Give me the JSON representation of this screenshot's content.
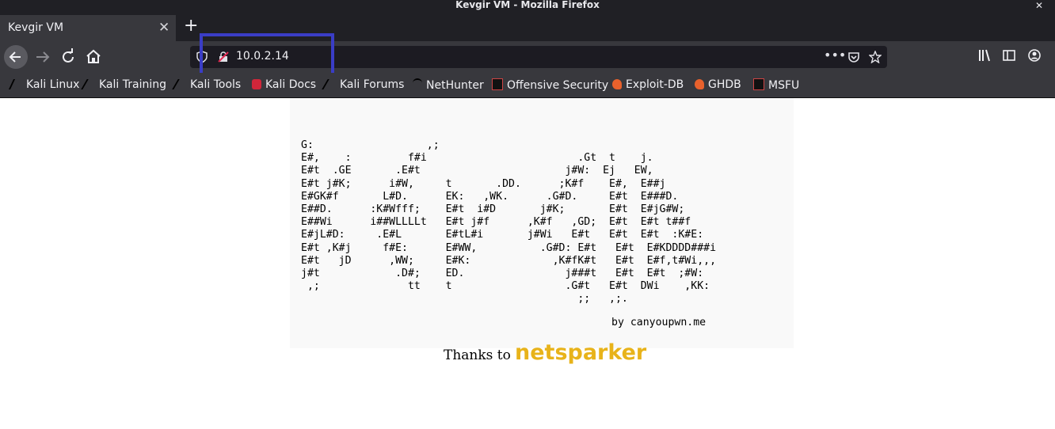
{
  "window": {
    "title": "Kevgir VM - Mozilla Firefox"
  },
  "tab": {
    "title": "Kevgir VM"
  },
  "urlbar": {
    "url": "10.0.2.14"
  },
  "bookmarks": [
    {
      "label": "Kali Linux"
    },
    {
      "label": "Kali Training"
    },
    {
      "label": "Kali Tools"
    },
    {
      "label": "Kali Docs"
    },
    {
      "label": "Kali Forums"
    },
    {
      "label": "NetHunter"
    },
    {
      "label": "Offensive Security"
    },
    {
      "label": "Exploit-DB"
    },
    {
      "label": "GHDB"
    },
    {
      "label": "MSFU"
    }
  ],
  "page": {
    "ascii_art": "G:                  ,;\nE#,    :         f#i                        .Gt  t    j.\nE#t  .GE       .E#t                       j#W:  Ej   EW,\nE#t j#K;      i#W,     t       .DD.      ;K#f    E#,  E##j\nE#GK#f       L#D.      EK:   ,WK.      .G#D.     E#t  E###D.\nE##D.      :K#Wfff;    E#t  i#D       j#K;       E#t  E#jG#W;\nE##Wi      i##WLLLLt   E#t j#f      ,K#f   ,GD;  E#t  E#t t##f\nE#jL#D:     .E#L       E#tL#i       j#Wi   E#t   E#t  E#t  :K#E:\nE#t ,K#j     f#E:      E#WW,          .G#D: E#t   E#t  E#KDDDD###i\nE#t   jD      ,WW;     E#K:             ,K#fK#t   E#t  E#f,t#Wi,,,\nj#t            .D#;    ED.                j###t   E#t  E#t  ;#W:\n ,;              tt    t                  .G#t   E#t  DWi    ,KK:\n                                            ;;   ,;.",
    "byline": "by canyoupwn.me",
    "thanks_text": "Thanks to",
    "logo_text": "netsparker"
  },
  "colors": {
    "chrome_dark": "#202025",
    "toolbar": "#38383d",
    "highlight_box": "#3a3dc6",
    "logo": "#e8b31a"
  }
}
